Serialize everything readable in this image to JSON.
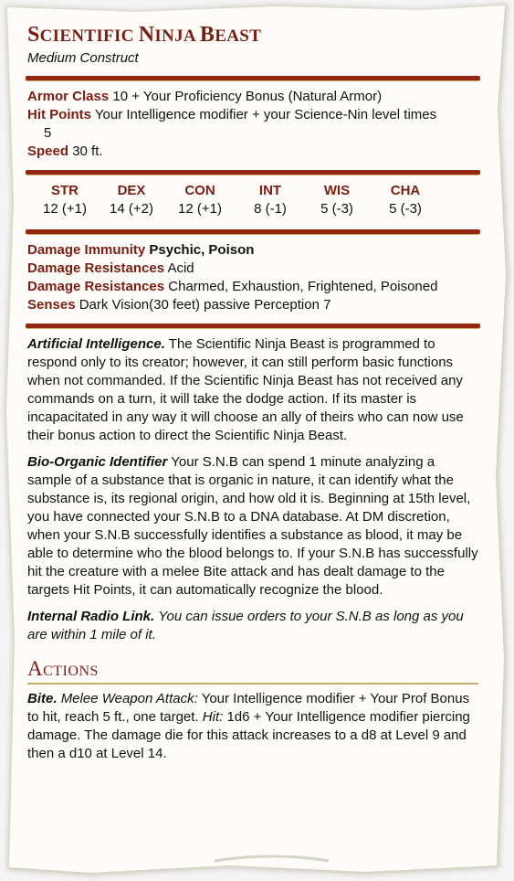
{
  "header": {
    "name_first_letters": [
      "S",
      "N",
      "B"
    ],
    "name_rest": [
      "CIENTIFIC ",
      "INJA ",
      "EAST"
    ],
    "name": "Scientific Ninja Beast",
    "subtitle": "Medium Construct"
  },
  "stats": {
    "armor_class": {
      "label": "Armor Class",
      "value": "10 + Your Proficiency Bonus (Natural Armor)"
    },
    "hit_points": {
      "label": "Hit Points",
      "value": "Your Intelligence modifier + your Science-Nin level times",
      "value2": "5"
    },
    "speed": {
      "label": "Speed",
      "value": "30 ft."
    }
  },
  "abilities": [
    {
      "name": "STR",
      "score": "12 (+1)"
    },
    {
      "name": "DEX",
      "score": "14 (+2)"
    },
    {
      "name": "CON",
      "score": "12 (+1)"
    },
    {
      "name": "INT",
      "score": "8 (-1)"
    },
    {
      "name": "WIS",
      "score": "5 (-3)"
    },
    {
      "name": "CHA",
      "score": "5 (-3)"
    }
  ],
  "properties": {
    "immunity": {
      "label": "Damage Immunity",
      "value": "Psychic, Poison"
    },
    "resistances1": {
      "label": "Damage Resistances",
      "value": "Acid"
    },
    "resistances2": {
      "label": "Damage Resistances",
      "value": "Charmed, Exhaustion, Frightened, Poisoned"
    },
    "senses": {
      "label": "Senses",
      "value": "Dark Vision(30 feet) passive Perception 7"
    }
  },
  "traits": [
    {
      "name": "Artificial Intelligence.",
      "text": "The Scientific Ninja Beast is programmed to respond only to its creator; however, it can still perform basic functions when not commanded. If the Scientific Ninja Beast has not received any commands on a turn, it will take the dodge action. If its master is incapacitated in any way it will choose an ally of theirs who can now use their bonus action to direct the Scientific Ninja Beast."
    },
    {
      "name": "Bio-Organic Identifier",
      "text": "Your S.N.B can spend 1 minute analyzing a sample of a substance that is organic in nature, it can identify what the substance is, its regional origin, and how old it is. Beginning at 15th level, you have connected your S.N.B to a DNA database. At DM discretion, when your S.N.B successfully identifies a substance as blood, it may be able to determine who the blood belongs to. If your S.N.B has successfully hit the creature with a melee Bite attack and has dealt damage to the targets Hit Points, it can automatically recognize the blood."
    },
    {
      "name": "Internal Radio Link.",
      "text": "You can issue orders to your S.N.B as long as you are within 1 mile of it."
    }
  ],
  "actions_heading": "Actions",
  "actions": [
    {
      "name": "Bite.",
      "type": "Melee Weapon Attack:",
      "text1": "Your Intelligence modifier + Your Prof Bonus to hit, reach 5 ft., one target.",
      "hit_label": "Hit:",
      "text2": "1d6 + Your Intelligence modifier piercing damage. The damage die for this attack increases to a d8 at Level 9 and then a d10 at Level 14."
    }
  ]
}
